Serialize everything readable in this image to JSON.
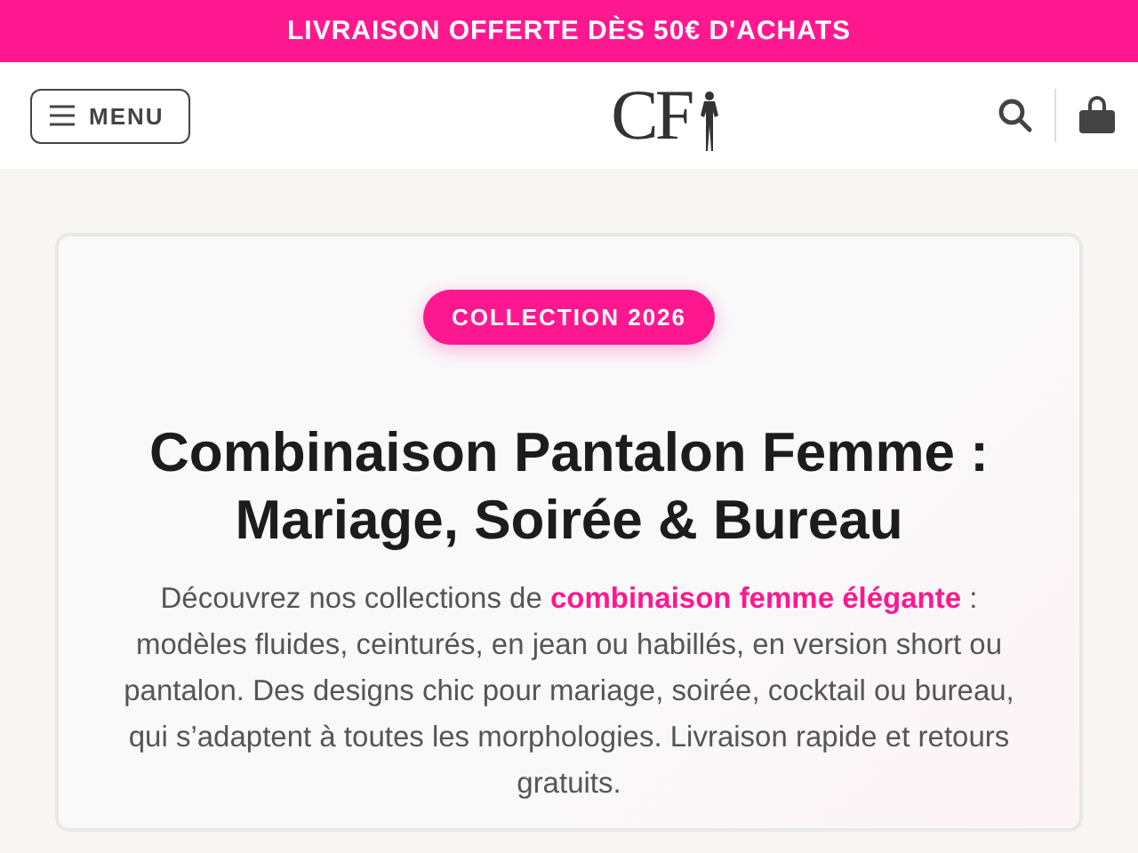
{
  "promo_bar": {
    "text": "LIVRAISON OFFERTE DÈS 50€ D'ACHATS"
  },
  "header": {
    "menu_button": "MENU",
    "logo": "CF"
  },
  "hero": {
    "badge": "COLLECTION 2026",
    "title": "Combinaison Pantalon Femme : Mariage, Soirée & Bureau",
    "intro": {
      "before": "Découvrez nos collections de ",
      "link": "combinaison femme élégante",
      "after": " : modèles fluides, ceinturés, en jean ou habillés, en version short ou pantalon. Des designs chic pour mariage, soirée, cocktail ou bureau, qui s’adaptent à toutes les morphologies. Livraison rapide et retours gratuits."
    }
  }
}
